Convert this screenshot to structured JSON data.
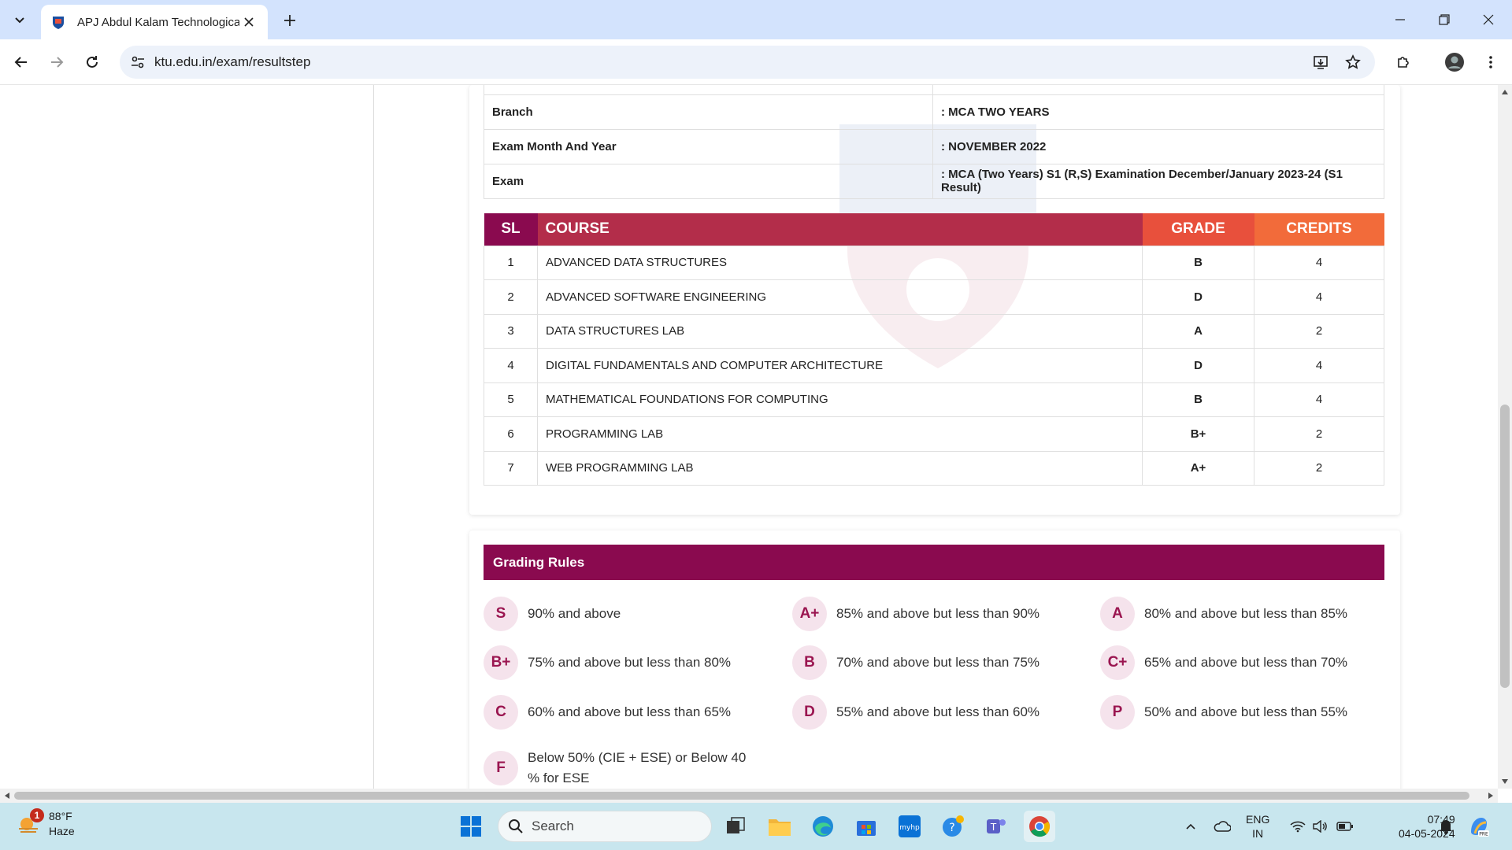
{
  "browser": {
    "tab_title": "APJ Abdul Kalam Technological",
    "url": "ktu.edu.in/exam/resultstep"
  },
  "student_info": {
    "rows": [
      {
        "label": "",
        "value": ""
      },
      {
        "label": "Branch",
        "value": ": MCA TWO YEARS"
      },
      {
        "label": "Exam Month And Year",
        "value": ": NOVEMBER 2022"
      },
      {
        "label": "Exam",
        "value": ": MCA (Two Years) S1 (R,S) Examination December/January 2023-24 (S1 Result)"
      }
    ]
  },
  "results": {
    "headers": {
      "sl": "SL",
      "course": "COURSE",
      "grade": "GRADE",
      "credits": "CREDITS"
    },
    "rows": [
      {
        "sl": "1",
        "course": "ADVANCED DATA STRUCTURES",
        "grade": "B",
        "credits": "4"
      },
      {
        "sl": "2",
        "course": "ADVANCED SOFTWARE ENGINEERING",
        "grade": "D",
        "credits": "4"
      },
      {
        "sl": "3",
        "course": "DATA STRUCTURES LAB",
        "grade": "A",
        "credits": "2"
      },
      {
        "sl": "4",
        "course": "DIGITAL FUNDAMENTALS AND COMPUTER ARCHITECTURE",
        "grade": "D",
        "credits": "4"
      },
      {
        "sl": "5",
        "course": "MATHEMATICAL FOUNDATIONS FOR COMPUTING",
        "grade": "B",
        "credits": "4"
      },
      {
        "sl": "6",
        "course": "PROGRAMMING LAB",
        "grade": "B+",
        "credits": "2"
      },
      {
        "sl": "7",
        "course": "WEB PROGRAMMING LAB",
        "grade": "A+",
        "credits": "2"
      }
    ]
  },
  "grading_rules": {
    "title": "Grading Rules",
    "rules": [
      {
        "grade": "S",
        "text": "90% and above"
      },
      {
        "grade": "A+",
        "text": "85% and above but less than 90%"
      },
      {
        "grade": "A",
        "text": "80% and above but less than 85%"
      },
      {
        "grade": "B+",
        "text": "75% and above but less than 80%"
      },
      {
        "grade": "B",
        "text": "70% and above but less than 75%"
      },
      {
        "grade": "C+",
        "text": "65% and above but less than 70%"
      },
      {
        "grade": "C",
        "text": "60% and above but less than 65%"
      },
      {
        "grade": "D",
        "text": "55% and above but less than 60%"
      },
      {
        "grade": "P",
        "text": "50% and above but less than 55%"
      },
      {
        "grade": "F",
        "text": "Below 50% (CIE + ESE) or Below 40 % for ESE"
      }
    ]
  },
  "taskbar": {
    "weather_alert_count": "1",
    "temperature": "88°F",
    "weather_condition": "Haze",
    "search_placeholder": "Search",
    "language_line1": "ENG",
    "language_line2": "IN",
    "time": "07:49",
    "date": "04-05-2024"
  },
  "colors": {
    "primary": "#8a0a4f",
    "course_header": "#b32d4a",
    "grade_header": "#e8503c",
    "credits_header": "#f26b3a",
    "badge_bg": "#f5e3ec"
  }
}
